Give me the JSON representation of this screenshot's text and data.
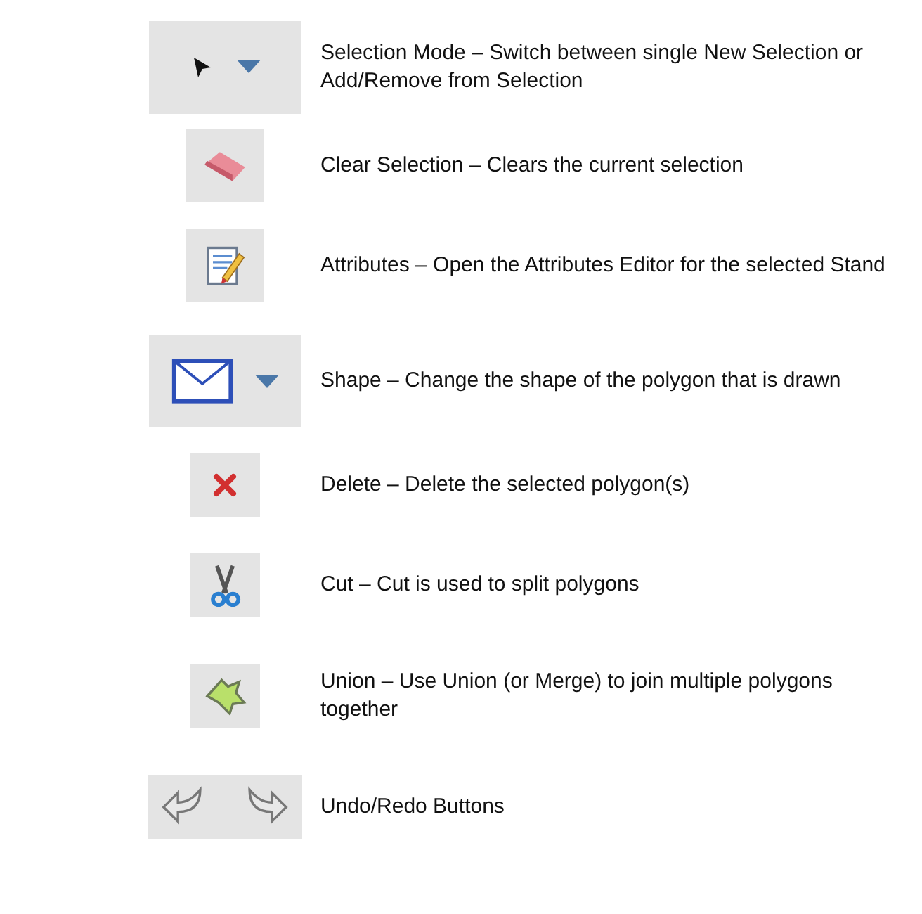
{
  "tools": [
    {
      "kind": "selection",
      "description": "Selection Mode – Switch between single New Selection or Add/Remove from Selection"
    },
    {
      "kind": "eraser",
      "description": "Clear Selection – Clears the current selection"
    },
    {
      "kind": "attributes",
      "description": "Attributes – Open the Attributes Editor for the selected Stand"
    },
    {
      "kind": "shape",
      "description": "Shape – Change the shape of the polygon that is drawn"
    },
    {
      "kind": "delete",
      "description": "Delete – Delete the selected polygon(s)"
    },
    {
      "kind": "cut",
      "description": "Cut – Cut is used to split polygons"
    },
    {
      "kind": "union",
      "description": "Union – Use Union (or Merge) to join multiple polygons together"
    },
    {
      "kind": "undoredo",
      "description": "Undo/Redo Buttons"
    }
  ]
}
